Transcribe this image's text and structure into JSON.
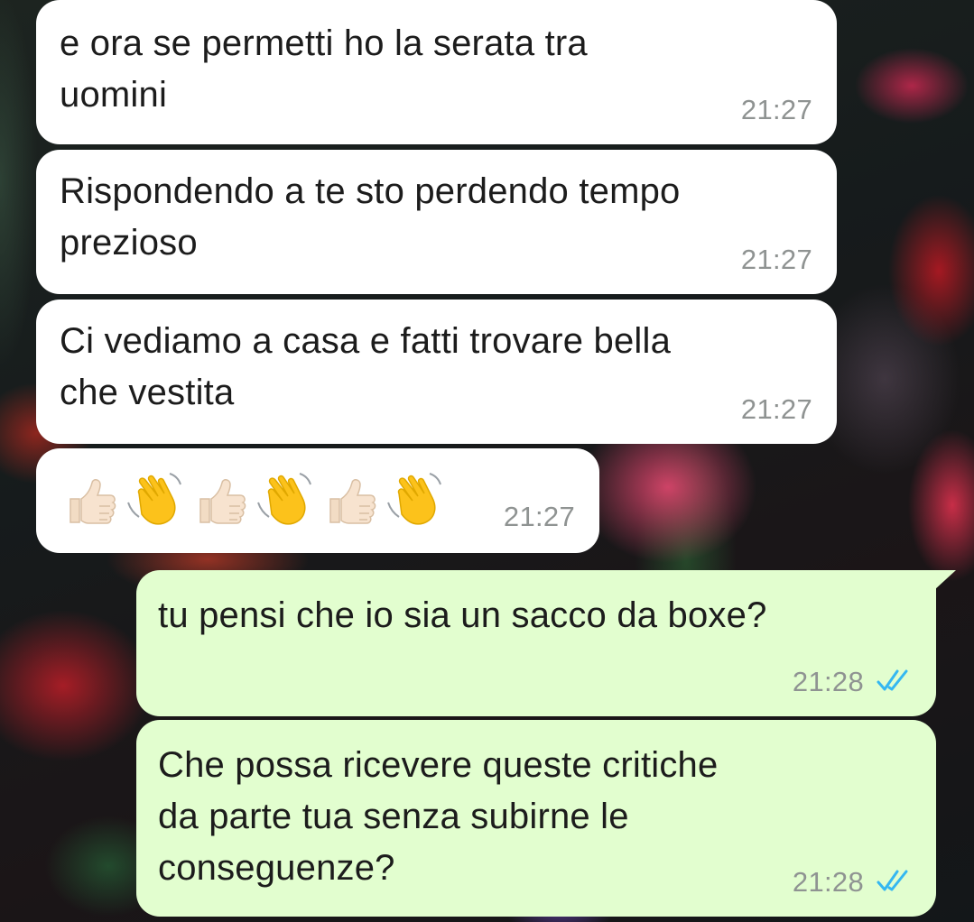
{
  "messages": [
    {
      "direction": "incoming",
      "text": "e ora se permetti ho la serata tra\nuomini",
      "time": "21:27"
    },
    {
      "direction": "incoming",
      "text": "Rispondendo a te sto perdendo tempo\nprezioso",
      "time": "21:27"
    },
    {
      "direction": "incoming",
      "text": "Ci vediamo a casa e fatti trovare bella\nche vestita",
      "time": "21:27"
    },
    {
      "direction": "incoming",
      "emoji": [
        "thumbs-up-icon",
        "waving-hand-icon",
        "thumbs-up-icon",
        "waving-hand-icon",
        "thumbs-up-icon",
        "waving-hand-icon"
      ],
      "time": "21:27"
    },
    {
      "direction": "outgoing",
      "text": "tu pensi che io sia un sacco da boxe?",
      "time": "21:28",
      "status": "read"
    },
    {
      "direction": "outgoing",
      "text": "Che possa ricevere queste critiche\nda parte tua senza subirne le\nconseguenze?",
      "time": "21:28",
      "status": "read"
    }
  ],
  "colors": {
    "incoming_bubble": "#ffffff",
    "outgoing_bubble": "#e2fecf",
    "time_text": "#8f9392",
    "read_ticks": "#34b7f1"
  }
}
